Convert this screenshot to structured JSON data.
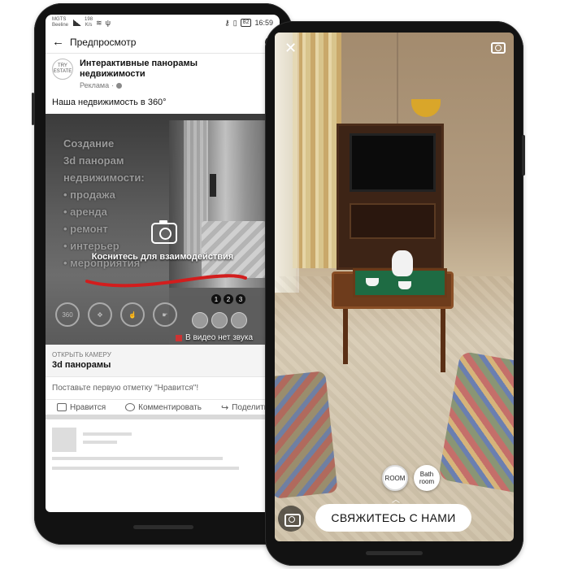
{
  "left_phone": {
    "status": {
      "carrier_1": "MGTS",
      "carrier_2": "Beeline",
      "speed_value": "198",
      "speed_unit": "K/s",
      "battery": "82",
      "time": "16:59"
    },
    "header": {
      "title": "Предпросмотр"
    },
    "post": {
      "logo_line1": "TRY",
      "logo_line2": "ESTATE",
      "page_name": "Интерактивные панорамы недвижимости",
      "sponsored": "Реклама",
      "text": "Наша недвижимость в 360°"
    },
    "media": {
      "overlay_lines": [
        "Создание",
        "3d панорам",
        "недвижимости:",
        "• продажа",
        "• аренда",
        "• ремонт",
        "• интерьер",
        "• мероприятия"
      ],
      "tap_label": "Коснитесь для взаимодействия",
      "gestures": [
        "360",
        "",
        "",
        ""
      ],
      "pager": [
        "1",
        "2",
        "3"
      ],
      "no_sound": "В видео нет звука"
    },
    "cta": {
      "kicker": "ОТКРЫТЬ КАМЕРУ",
      "title": "3d панорамы"
    },
    "likes_prompt": "Поставьте первую отметку \"Нравится\"!",
    "actions": {
      "like": "Нравится",
      "comment": "Комментировать",
      "share": "Поделить"
    }
  },
  "right_phone": {
    "scenes": [
      {
        "line1": "ROOM",
        "line2": "",
        "selected": true
      },
      {
        "line1": "Bath",
        "line2": "room",
        "selected": false
      }
    ],
    "contact_button": "СВЯЖИТЕСЬ С НАМИ",
    "icons": [
      "close-icon",
      "flip-camera-icon",
      "camera-icon"
    ]
  },
  "colors": {
    "swoosh": "#d21d1d",
    "tray": "#1e6b43",
    "cabinet": "#3d2416"
  }
}
